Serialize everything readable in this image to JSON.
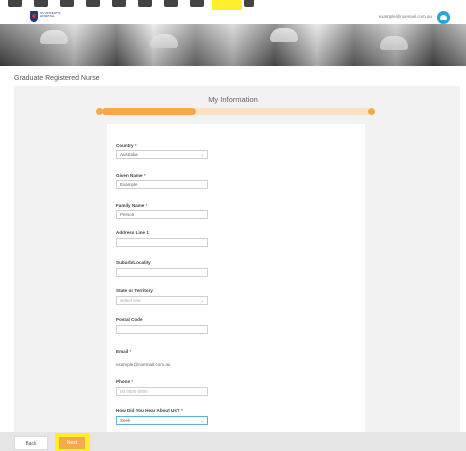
{
  "header": {
    "logo_text": "ST VINCENT'S HOSPITAL",
    "user_email": "example@noemail.com.au"
  },
  "page": {
    "title": "Graduate Registered Nurse",
    "section_title": "My Information",
    "progress_fraction": 0.35
  },
  "form": {
    "country": {
      "label": "Country",
      "value": "Australia"
    },
    "given_name": {
      "label": "Given Name",
      "value": "Example"
    },
    "family_name": {
      "label": "Family Name",
      "value": "Person"
    },
    "address_line_1": {
      "label": "Address Line 1",
      "value": ""
    },
    "suburb": {
      "label": "Suburb/Locality",
      "value": ""
    },
    "state": {
      "label": "State or Territory",
      "placeholder": "select one"
    },
    "postal_code": {
      "label": "Postal Code",
      "value": ""
    },
    "email": {
      "label": "Email",
      "value": "example@noemail.com.au"
    },
    "phone": {
      "label": "Phone",
      "value": "00 0000 0000"
    },
    "heard_about": {
      "label": "How Did You Hear About Us?",
      "value": "Seek"
    },
    "required_mark": "*"
  },
  "footer": {
    "back_label": "Back",
    "next_label": "Next"
  },
  "colors": {
    "accent": "#f5a94c",
    "highlight": "#ffef2a",
    "required": "#d9534f",
    "avatar": "#2aa6d6"
  }
}
